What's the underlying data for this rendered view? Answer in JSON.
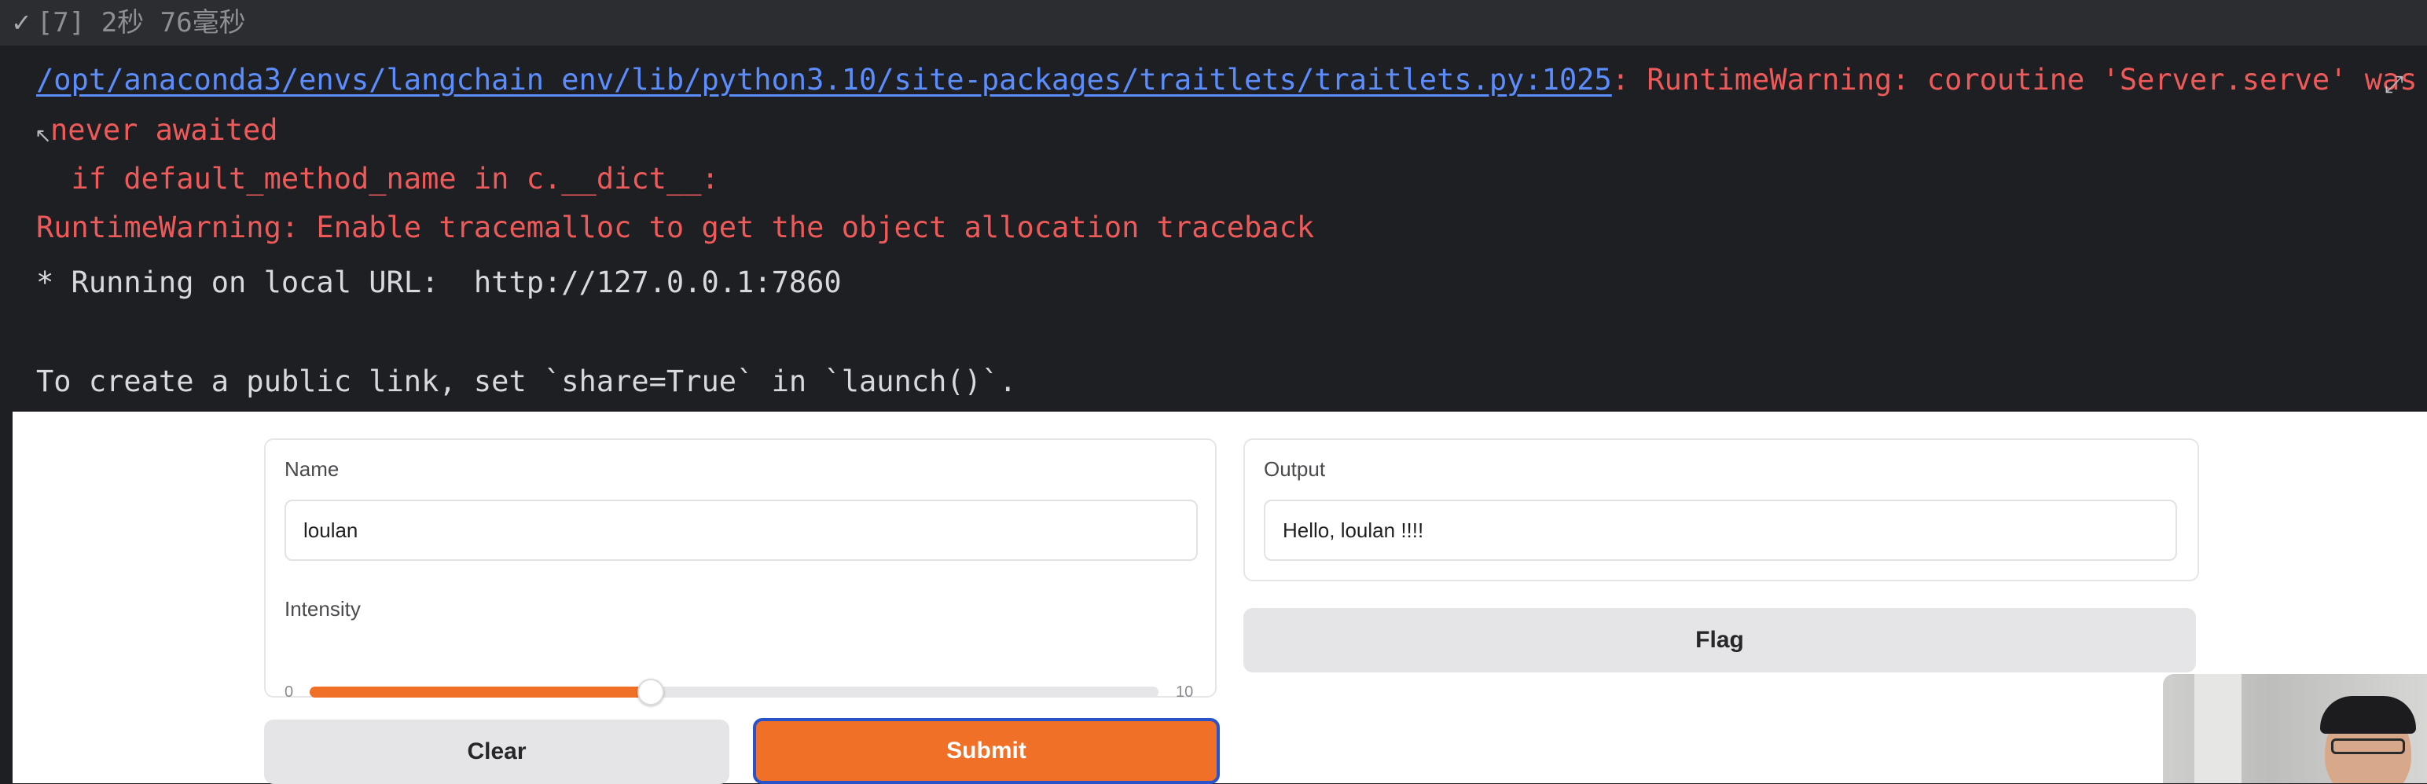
{
  "cell": {
    "status_check": "✓",
    "status_text": "[7] 2秒 76毫秒"
  },
  "output": {
    "warning_path": "/opt/anaconda3/envs/langchain_env/lib/python3.10/site-packages/traitlets/traitlets.py:1025",
    "warning_msg": ": RuntimeWarning: coroutine 'Server.serve' was",
    "warning_cont": "never awaited",
    "code_line": "  if default_method_name in c.__dict__:",
    "tracemalloc": "RuntimeWarning: Enable tracemalloc to get the object allocation traceback",
    "running": "* Running on local URL:  http://127.0.0.1:7860",
    "share_hint": "To create a public link, set `share=True` in `launch()`."
  },
  "gradio": {
    "name_label": "Name",
    "name_value": "loulan",
    "intensity_label": "Intensity",
    "intensity_value": "4",
    "slider_min": "0",
    "slider_max": "10",
    "slider_fraction": 0.4,
    "output_label": "Output",
    "output_value": "Hello, loulan !!!!",
    "flag_label": "Flag",
    "clear_label": "Clear",
    "submit_label": "Submit"
  },
  "colors": {
    "accent": "#f07028",
    "warning_text": "#ee5a5a",
    "link": "#5c8dff"
  },
  "icons": {
    "reset": "reset-icon",
    "expand": "expand-icon"
  }
}
